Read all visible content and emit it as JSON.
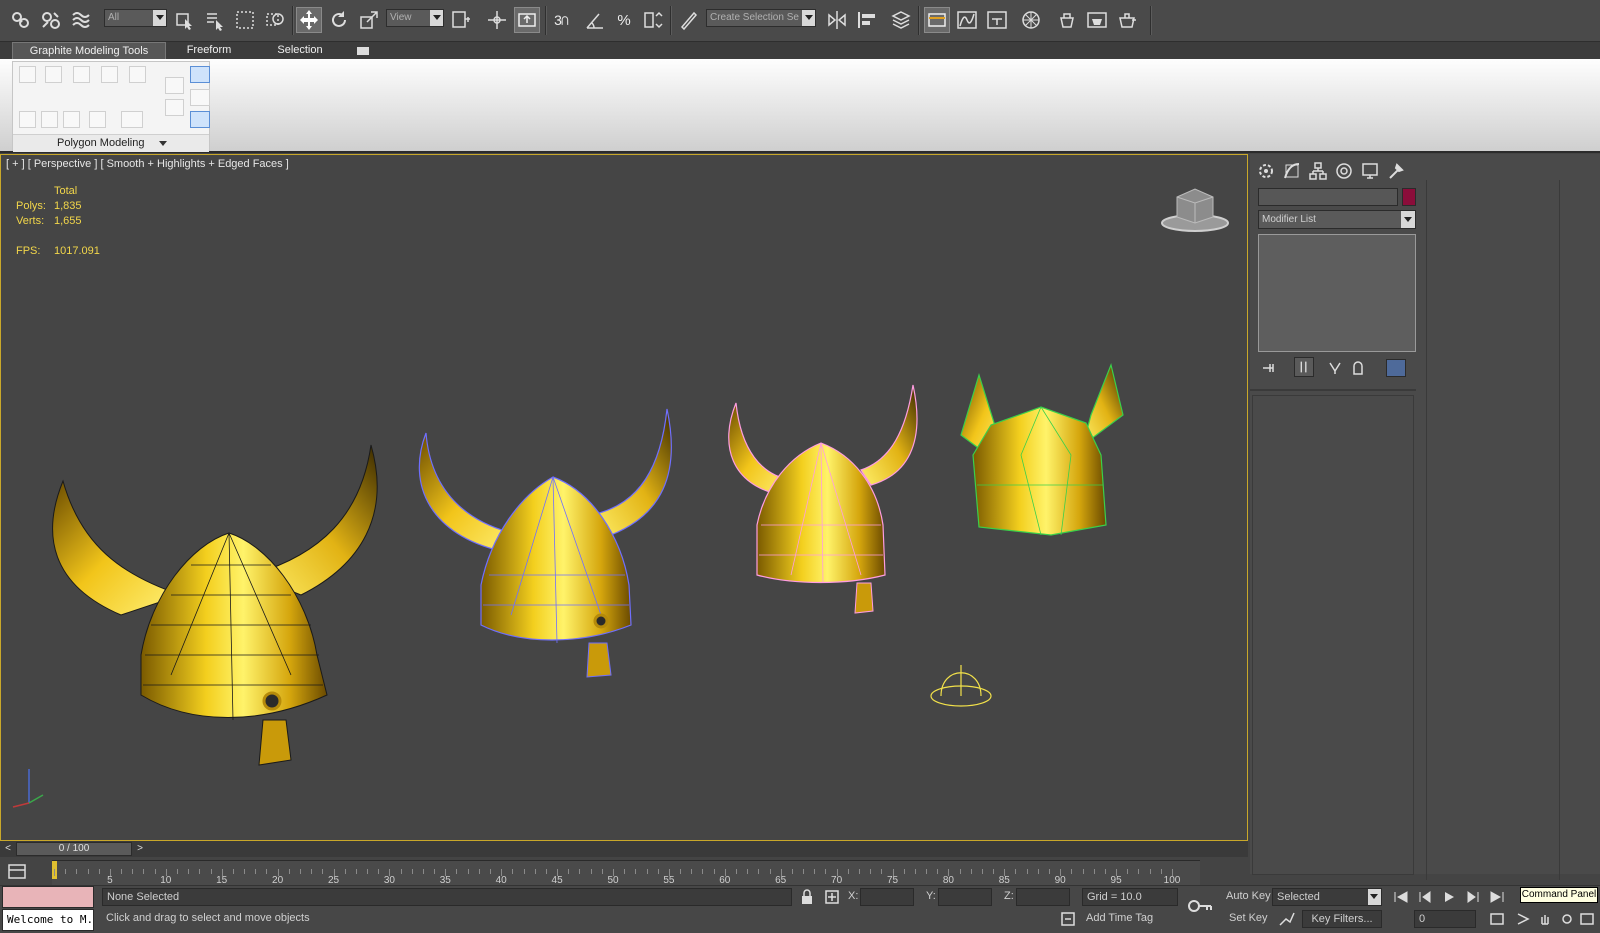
{
  "toolbar": {
    "selection_filter": "All",
    "ref_coord": "View",
    "named_selection_placeholder": "Create Selection Se",
    "snap_number": "3",
    "icons": [
      "link-icon",
      "unlink-icon",
      "bind-space-warp-icon",
      "select-object-icon",
      "select-by-name-icon",
      "rect-region-icon",
      "window-crossing-icon",
      "select-move-icon",
      "select-rotate-icon",
      "select-scale-icon",
      "pivot-icon",
      "manipulate-icon",
      "snap-icon",
      "angle-snap-icon",
      "percent-snap-icon",
      "spinner-snap-icon",
      "edit-named-sel-icon",
      "mirror-icon",
      "align-icon",
      "layer-icon",
      "ribbon-toggle-icon",
      "curve-editor-icon",
      "schematic-icon",
      "material-editor-icon",
      "render-setup-icon",
      "rendered-frame-icon",
      "render-icon"
    ]
  },
  "ribbon": {
    "tabs": [
      "Graphite Modeling Tools",
      "Freeform",
      "Selection"
    ],
    "panel_label": "Polygon Modeling"
  },
  "viewport": {
    "label": "[ + ] [ Perspective ] [ Smooth + Highlights + Edged Faces ]",
    "stats": {
      "total_label": "Total",
      "polys_label": "Polys:",
      "polys_value": "1,835",
      "verts_label": "Verts:",
      "verts_value": "1,655",
      "fps_label": "FPS:",
      "fps_value": "1017.091"
    },
    "objects": [
      "viking-helmet-high-poly",
      "viking-helmet-blue-wire",
      "viking-helmet-pink-wire",
      "viking-helmet-green-low",
      "helmet-gizmo"
    ]
  },
  "command_panel": {
    "tabs": [
      "create-icon",
      "modify-icon",
      "hierarchy-icon",
      "motion-icon",
      "display-icon",
      "utilities-icon"
    ],
    "name_value": "",
    "modifier_list": "Modifier List",
    "stack_buttons": [
      "pin-stack-icon",
      "show-end-result-icon",
      "make-unique-icon",
      "remove-modifier-icon",
      "configure-sets-icon"
    ],
    "swatch_color": "#8b0d3a"
  },
  "timeline": {
    "slider_label": "0 / 100",
    "ticks": [
      "5",
      "10",
      "15",
      "20",
      "25",
      "30",
      "35",
      "40",
      "45",
      "50",
      "55",
      "60",
      "65",
      "70",
      "75",
      "80",
      "85",
      "90",
      "95",
      "100"
    ]
  },
  "status": {
    "maxscript": "Welcome to M.",
    "selection": "None Selected",
    "prompt": "Click and drag to select and move objects",
    "x_label": "X:",
    "y_label": "Y:",
    "z_label": "Z:",
    "grid": "Grid = 10.0",
    "add_time_tag": "Add Time Tag",
    "auto_key": "Auto Key",
    "set_key": "Set Key",
    "key_mode": "Selected",
    "key_filters": "Key Filters...",
    "current_frame": "0",
    "tooltip": "Command Panel"
  },
  "colors": {
    "selection_yellow": "#c9a82a",
    "helmet_gold": "#e8c020",
    "wire_blue": "#6f6fff",
    "wire_pink": "#ff9de0",
    "wire_green": "#3ad04a"
  }
}
